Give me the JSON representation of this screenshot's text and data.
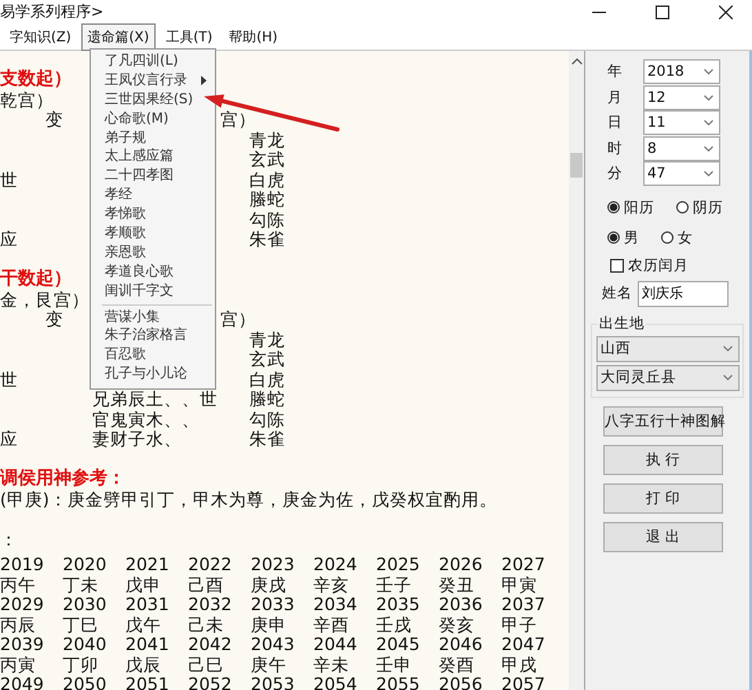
{
  "window": {
    "title": "易学系列程序>"
  },
  "menu_bar": [
    {
      "label": "字知识(Z)",
      "selected": false
    },
    {
      "label": "遗命篇(X)",
      "selected": true
    },
    {
      "label": "工具(T)",
      "selected": false
    },
    {
      "label": "帮助(H)",
      "selected": false
    }
  ],
  "open_menu": {
    "items": [
      {
        "kind": "item",
        "label": "了凡四训(L)"
      },
      {
        "kind": "submenu",
        "label": "王凤仪言行录"
      },
      {
        "kind": "item",
        "label": "三世因果经(S)"
      },
      {
        "kind": "item",
        "label": "心命歌(M)"
      },
      {
        "kind": "item",
        "label": "弟子规"
      },
      {
        "kind": "item",
        "label": "太上感应篇"
      },
      {
        "kind": "item",
        "label": "二十四孝图"
      },
      {
        "kind": "item",
        "label": "孝经"
      },
      {
        "kind": "item",
        "label": "孝悌歌"
      },
      {
        "kind": "item",
        "label": "孝顺歌"
      },
      {
        "kind": "item",
        "label": "亲恩歌"
      },
      {
        "kind": "item",
        "label": "孝道良心歌"
      },
      {
        "kind": "item",
        "label": "闺训千字文"
      },
      {
        "kind": "separator"
      },
      {
        "kind": "item",
        "label": "营谋小集"
      },
      {
        "kind": "item",
        "label": "朱子治家格言"
      },
      {
        "kind": "item",
        "label": "百忍歌"
      },
      {
        "kind": "item",
        "label": "孔子与小儿论"
      }
    ]
  },
  "text_area": {
    "lines": [
      {
        "kind": "heading",
        "left": "支数起）"
      },
      {
        "kind": "plain",
        "left": "乾宫）"
      },
      {
        "kind": "plain",
        "indent": "变",
        "tail": "宫）"
      },
      {
        "kind": "plain",
        "right": "青龙"
      },
      {
        "kind": "plain",
        "right": "玄武"
      },
      {
        "kind": "plain",
        "left": "世",
        "right": "白虎"
      },
      {
        "kind": "plain",
        "right": "螣蛇"
      },
      {
        "kind": "plain",
        "right": "勾陈"
      },
      {
        "kind": "plain",
        "left": "应",
        "right": "朱雀"
      },
      {
        "kind": "blank"
      },
      {
        "kind": "heading",
        "left": "干数起）"
      },
      {
        "kind": "plain",
        "left": "金，艮宫）"
      },
      {
        "kind": "plain",
        "indent": "变",
        "tail": "宫）"
      },
      {
        "kind": "plain",
        "right": "青龙"
      },
      {
        "kind": "plain",
        "right": "玄武"
      },
      {
        "kind": "plain",
        "left": "世",
        "right": "白虎"
      },
      {
        "kind": "plain",
        "mid": "兄弟辰土、、世",
        "right": "螣蛇"
      },
      {
        "kind": "plain",
        "mid": "官鬼寅木、、",
        "right": "勾陈"
      },
      {
        "kind": "plain",
        "left": "应",
        "mid": "妻财子水、",
        "right": "朱雀"
      },
      {
        "kind": "blank"
      },
      {
        "kind": "heading",
        "left": "调侯用神参考："
      },
      {
        "kind": "plain",
        "left": "(甲庚)：庚金劈甲引丁，甲木为尊，庚金为佐，戊癸权宜酌用。"
      },
      {
        "kind": "blank"
      },
      {
        "kind": "plain",
        "left": "："
      }
    ]
  },
  "year_table": {
    "rows": [
      [
        "2019",
        "2020",
        "2021",
        "2022",
        "2023",
        "2024",
        "2025",
        "2026",
        "2027"
      ],
      [
        "丙午",
        "丁未",
        "戊申",
        "己酉",
        "庚戌",
        "辛亥",
        "壬子",
        "癸丑",
        "甲寅"
      ],
      [
        "2029",
        "2030",
        "2031",
        "2032",
        "2033",
        "2034",
        "2035",
        "2036",
        "2037"
      ],
      [
        "丙辰",
        "丁巳",
        "戊午",
        "己未",
        "庚申",
        "辛酉",
        "壬戌",
        "癸亥",
        "甲子"
      ],
      [
        "2039",
        "2040",
        "2041",
        "2042",
        "2043",
        "2044",
        "2045",
        "2046",
        "2047"
      ],
      [
        "丙寅",
        "丁卯",
        "戊辰",
        "己巳",
        "庚午",
        "辛未",
        "壬申",
        "癸酉",
        "甲戌"
      ],
      [
        "2049",
        "2050",
        "2051",
        "2052",
        "2053",
        "2054",
        "2055",
        "2056",
        "2057"
      ]
    ]
  },
  "date_fields": [
    {
      "label": "年",
      "value": "2018"
    },
    {
      "label": "月",
      "value": "12"
    },
    {
      "label": "日",
      "value": "11"
    },
    {
      "label": "时",
      "value": "8"
    },
    {
      "label": "分",
      "value": "47"
    }
  ],
  "calendar_radios": [
    {
      "label": "阳历",
      "selected": true
    },
    {
      "label": "阴历",
      "selected": false
    }
  ],
  "gender_radios": [
    {
      "label": "男",
      "selected": true
    },
    {
      "label": "女",
      "selected": false
    }
  ],
  "leap_month": {
    "label": "农历闰月",
    "checked": false
  },
  "name_field": {
    "label": "姓名",
    "value": "刘庆乐"
  },
  "birthplace": {
    "label": "出生地",
    "province": "山西",
    "county": "大同灵丘县"
  },
  "buttons": [
    "八字五行十神图解",
    "执 行",
    "打 印",
    "退 出"
  ]
}
